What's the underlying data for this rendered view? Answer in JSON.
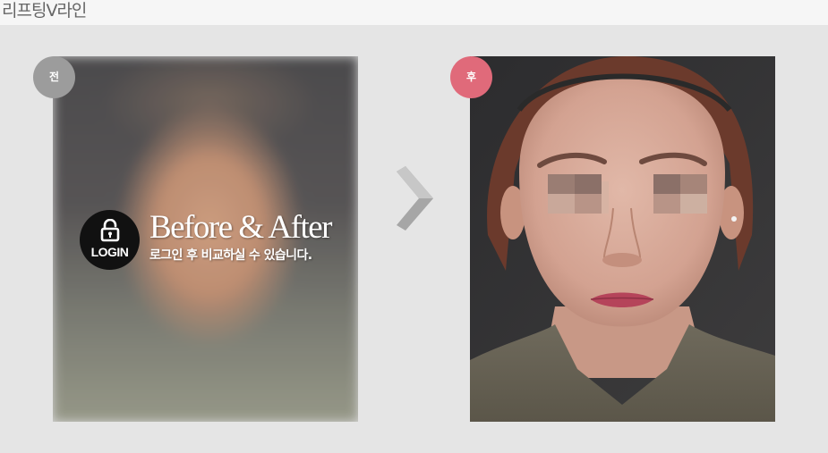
{
  "page": {
    "title": "리프팅V라인"
  },
  "before": {
    "badge": "전",
    "login_label": "LOGIN",
    "overlay_title": "Before & After",
    "overlay_subtitle": "로그인 후 비교하실 수 있습니다."
  },
  "after": {
    "badge": "후"
  },
  "colors": {
    "before_badge": "#9c9c9c",
    "after_badge": "#e06a7a",
    "background": "#e5e5e5"
  },
  "icons": {
    "lock": "lock-icon",
    "next": "chevron-right-icon"
  }
}
